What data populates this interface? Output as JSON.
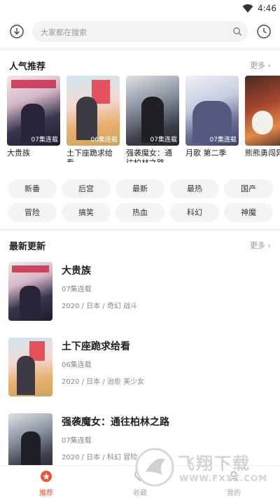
{
  "status": {
    "time": "4:46"
  },
  "search": {
    "placeholder": "大家都在搜索"
  },
  "popular": {
    "title": "人气推荐",
    "more": "更多",
    "items": [
      {
        "name": "大贵族",
        "badge": "07集连载"
      },
      {
        "name": "土下座跪求给看",
        "badge": "06集连载"
      },
      {
        "name": "强袭魔女：通往柏林之路",
        "badge": "07集连载"
      },
      {
        "name": "月歌 第二季",
        "badge": "07集连载"
      },
      {
        "name": "熊熊勇闯异",
        "badge": ""
      }
    ]
  },
  "tags": [
    "新番",
    "后宫",
    "最新",
    "最热",
    "国产",
    "冒险",
    "搞笑",
    "热血",
    "科幻",
    "神魔"
  ],
  "latest": {
    "title": "最新更新",
    "more": "更多",
    "items": [
      {
        "title": "大贵族",
        "status": "07集连载",
        "meta": "2020 / 日本 / 奇幻 战斗"
      },
      {
        "title": "土下座跪求给看",
        "status": "06集连载",
        "meta": "2020 / 日本 / 治愈 美少女"
      },
      {
        "title": "强袭魔女：通往柏林之路",
        "status": "07集连载",
        "meta": "2020 / 日本 / 科幻 冒险"
      }
    ]
  },
  "nav": [
    {
      "label": "推荐",
      "icon": "recommend-icon",
      "active": true
    },
    {
      "label": "收藏",
      "icon": "favorites-icon",
      "active": false
    },
    {
      "label": "我的",
      "icon": "profile-icon",
      "active": false
    }
  ],
  "watermark": {
    "text": "飞翔下载",
    "domain": "WWW.FXXZ.COM"
  },
  "colors": {
    "accent": "#f0522f"
  }
}
